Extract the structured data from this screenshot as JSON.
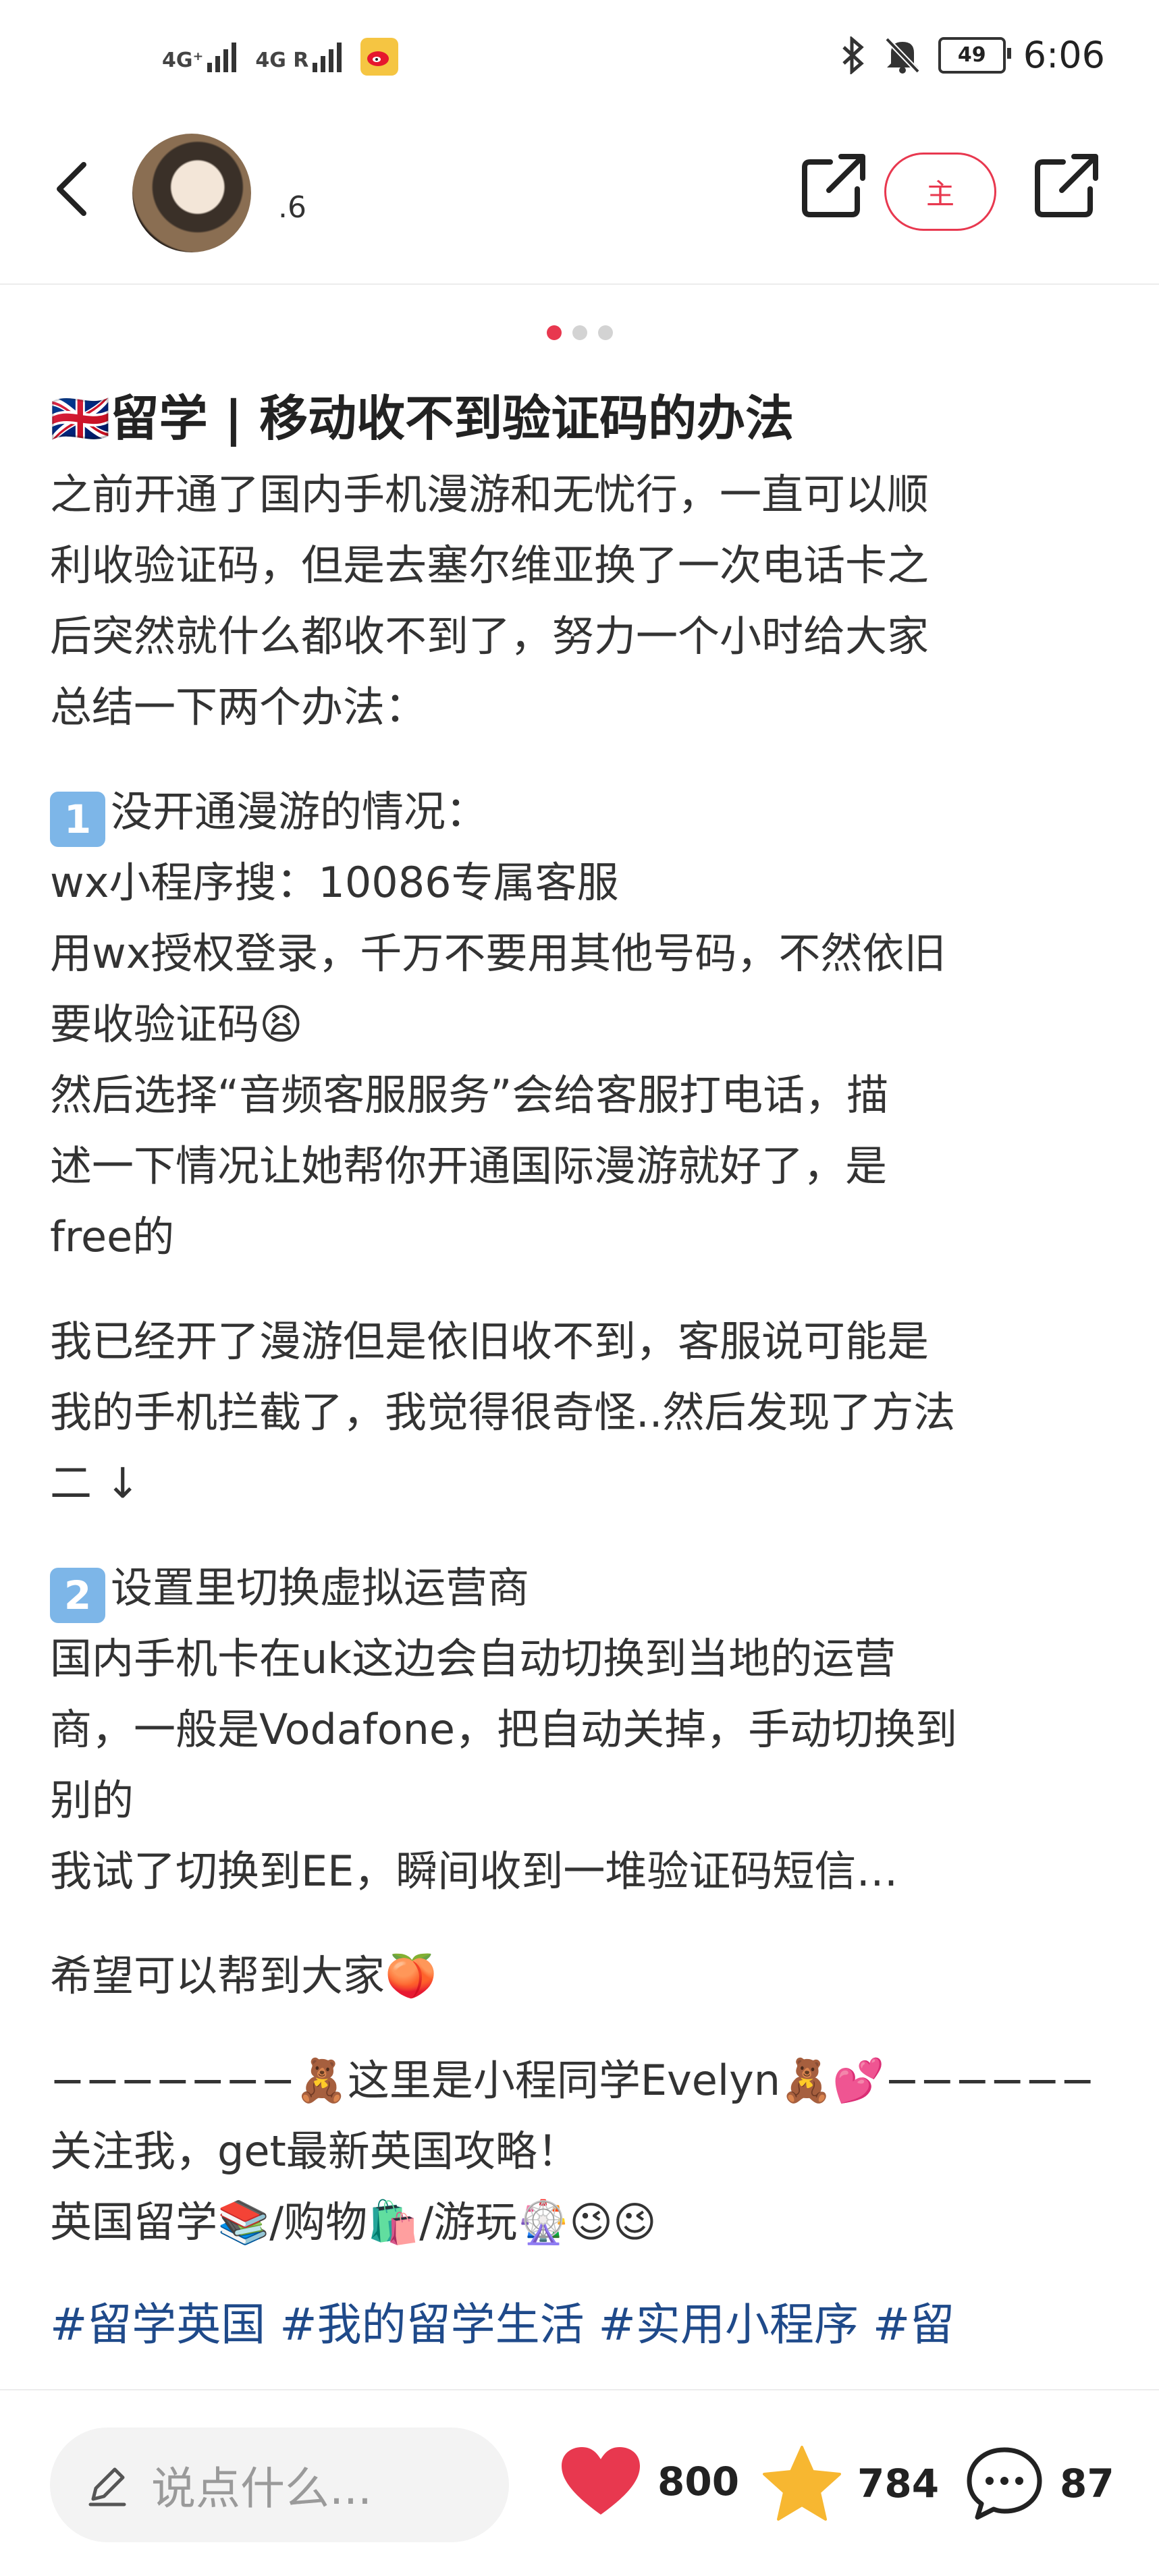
{
  "status_bar": {
    "signal1": "4G⁺",
    "signal2": "4G R",
    "battery": "49",
    "time": "6:06"
  },
  "header": {
    "author_name": ".6",
    "follow_label": "主"
  },
  "carousel": {
    "total": 3,
    "active": 1
  },
  "post": {
    "title": "🇬🇧留学 | 移动收不到验证码的办法",
    "intro": [
      "之前开通了国内手机漫游和无忧行，一直可以顺",
      "利收验证码，但是去塞尔维亚换了一次电话卡之",
      "后突然就什么都收不到了，努力一个小时给大家",
      "总结一下两个办法："
    ],
    "method1_num": "1",
    "method1_title": "没开通漫游的情况：",
    "method1_lines": [
      "wx小程序搜：10086专属客服",
      "用wx授权登录，千万不要用其他号码，不然依旧",
      "要收验证码😫",
      "然后选择“音频客服服务”会给客服打电话，描",
      "述一下情况让她帮你开通国际漫游就好了，是",
      "free的"
    ],
    "middle_lines": [
      "我已经开了漫游但是依旧收不到，客服说可能是",
      "我的手机拦截了，我觉得很奇怪..然后发现了方法",
      "二 ↓"
    ],
    "method2_num": "2",
    "method2_title": "设置里切换虚拟运营商",
    "method2_lines": [
      "国内手机卡在uk这边会自动切换到当地的运营",
      "商，一般是Vodafone，把自动关掉，手动切换到",
      "别的",
      "我试了切换到EE，瞬间收到一堆验证码短信…"
    ],
    "hope": "希望可以帮到大家🍑",
    "signature_lines": [
      "−−−−−−−🧸这里是小程同学Evelyn🧸💕−−−−−−",
      "关注我，get最新英国攻略！",
      "英国留学📚/购物🛍️/游玩🎡😉😉"
    ],
    "tags": "#留学英国 #我的留学生活 #实用小程序 #留"
  },
  "bottom_bar": {
    "comment_placeholder": "说点什么...",
    "likes": "800",
    "favorites": "784",
    "comments": "87"
  },
  "colors": {
    "accent": "#e8384f",
    "tag": "#1f4a8a",
    "star": "#f7b731"
  },
  "icons": [
    "back-icon",
    "share-icon",
    "heart-icon",
    "star-icon",
    "comment-bubble-icon",
    "pen-icon",
    "bluetooth-icon",
    "mute-icon",
    "weibo-icon"
  ]
}
